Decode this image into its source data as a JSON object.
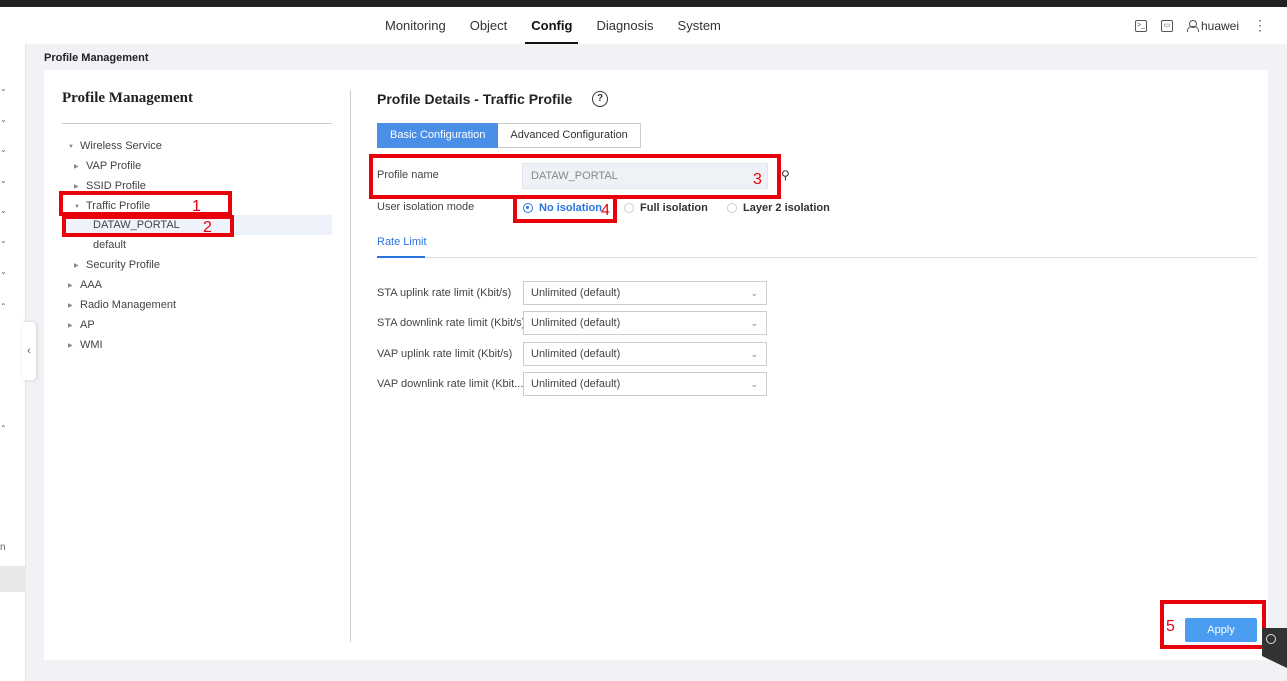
{
  "topnav": {
    "items": [
      {
        "label": "Monitoring",
        "active": false
      },
      {
        "label": "Object",
        "active": false
      },
      {
        "label": "Config",
        "active": true
      },
      {
        "label": "Diagnosis",
        "active": false
      },
      {
        "label": "System",
        "active": false
      }
    ],
    "username": "huawei",
    "terminal_icon_glyph": ">_",
    "more_glyph": "⋮"
  },
  "leftnav": {
    "chevron_down": "⌄",
    "chevron_up": "⌃",
    "collapse_glyph": "‹",
    "partial_label": "n"
  },
  "breadcrumb": "Profile Management",
  "tree": {
    "title": "Profile Management",
    "items": [
      {
        "label": "Wireless Service",
        "caret": "▼"
      },
      {
        "label": "VAP Profile",
        "caret": "▶"
      },
      {
        "label": "SSID Profile",
        "caret": "▶"
      },
      {
        "label": "Traffic Profile",
        "caret": "▼"
      },
      {
        "label": "DATAW_PORTAL",
        "caret": ""
      },
      {
        "label": "default",
        "caret": ""
      },
      {
        "label": "Security Profile",
        "caret": "▶"
      },
      {
        "label": "AAA",
        "caret": "▶"
      },
      {
        "label": "Radio Management",
        "caret": "▶"
      },
      {
        "label": "AP",
        "caret": "▶"
      },
      {
        "label": "WMI",
        "caret": "▶"
      }
    ]
  },
  "details": {
    "title": "Profile Details - Traffic Profile",
    "help_glyph": "?",
    "tabs": [
      {
        "label": "Basic Configuration",
        "active": true
      },
      {
        "label": "Advanced Configuration",
        "active": false
      }
    ],
    "profile_name_label": "Profile name",
    "profile_name_value": "DATAW_PORTAL",
    "name_action_glyph": "⚲",
    "isolation_label": "User isolation mode",
    "isolation_options": [
      {
        "label": "No isolation",
        "selected": true
      },
      {
        "label": "Full isolation",
        "selected": false
      },
      {
        "label": "Layer 2 isolation",
        "selected": false
      }
    ],
    "rate_tab": "Rate Limit",
    "rate_fields": [
      {
        "label": "STA uplink rate limit (Kbit/s)",
        "value": "Unlimited (default)"
      },
      {
        "label": "STA downlink rate limit (Kbit/s)",
        "value": "Unlimited (default)"
      },
      {
        "label": "VAP uplink rate limit (Kbit/s)",
        "value": "Unlimited (default)"
      },
      {
        "label": "VAP downlink rate limit (Kbit...",
        "value": "Unlimited (default)"
      }
    ],
    "select_chevron": "⌄",
    "apply_label": "Apply"
  },
  "annotations": [
    "1",
    "2",
    "3",
    "4",
    "5"
  ],
  "colors": {
    "primary": "#4a8fe7",
    "annotation": "#e8000b",
    "link": "#2a74e0"
  }
}
